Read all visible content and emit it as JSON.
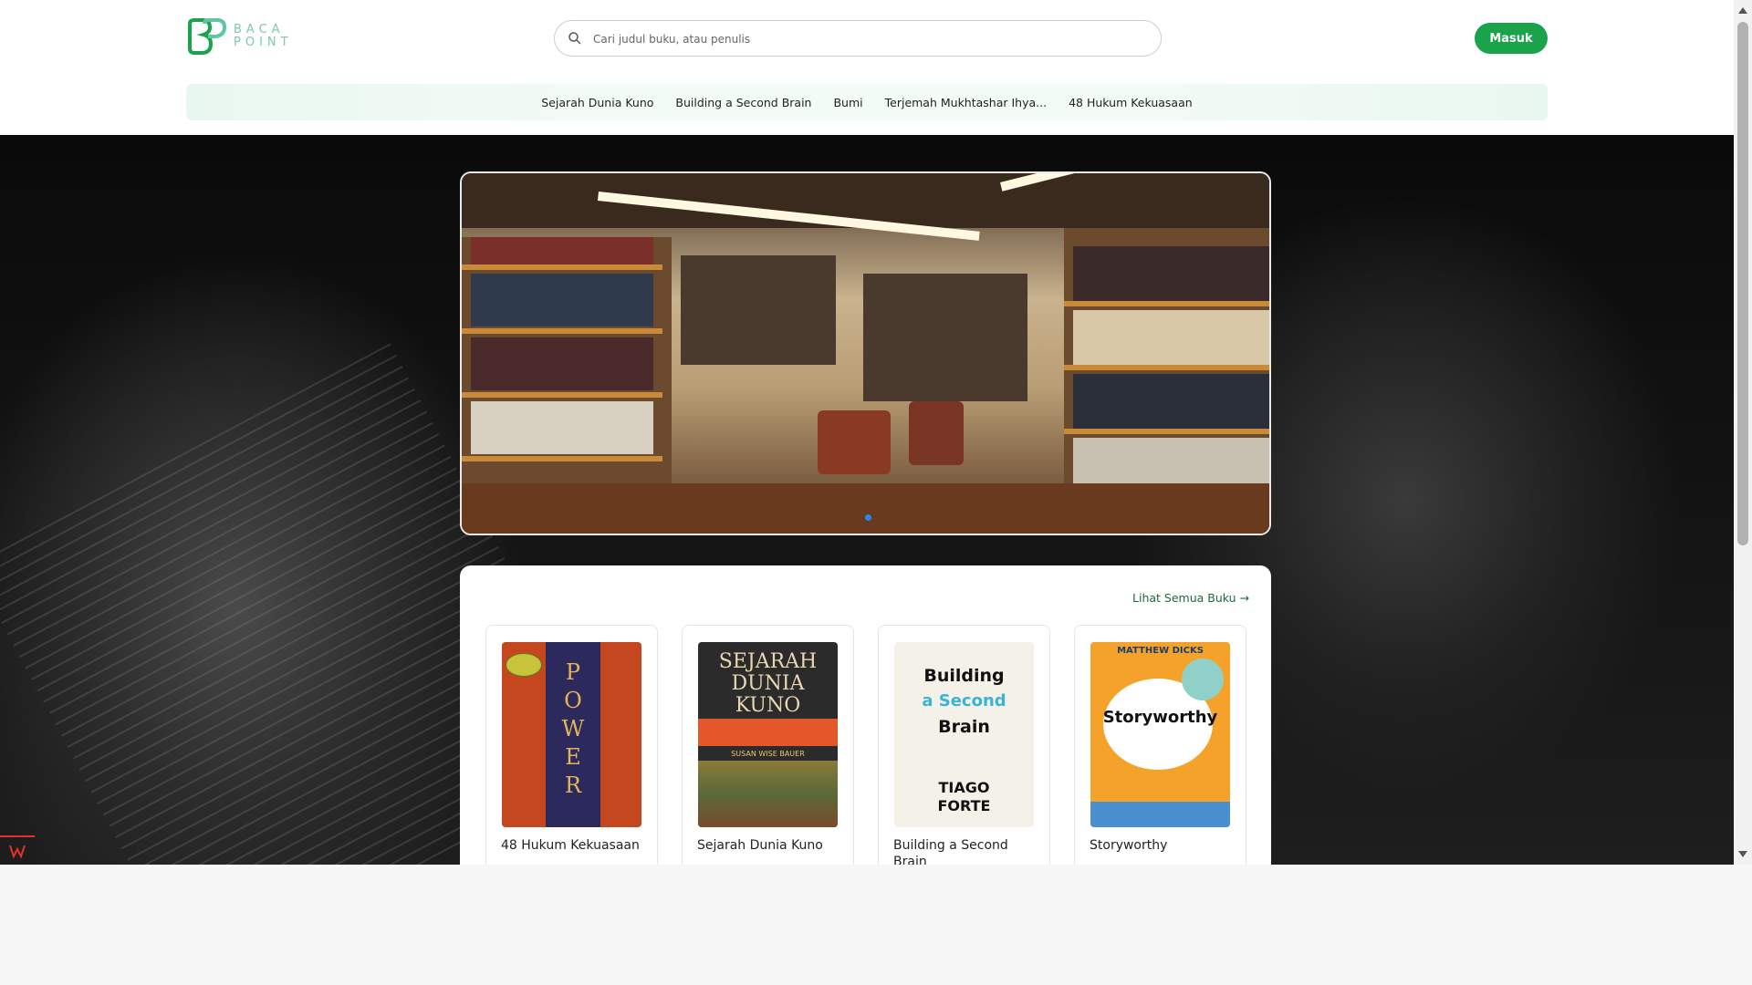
{
  "brand": {
    "name_line1": "BACA",
    "name_line2": "POINT",
    "color": "#1aa34a"
  },
  "search": {
    "placeholder": "Cari judul buku, atau penulis"
  },
  "header": {
    "login_label": "Masuk"
  },
  "nav": {
    "items": [
      {
        "label": "Sejarah Dunia Kuno"
      },
      {
        "label": "Building a Second Brain"
      },
      {
        "label": "Bumi"
      },
      {
        "label": "Terjemah Mukhtashar Ihya..."
      },
      {
        "label": "48 Hukum Kekuasaan"
      }
    ]
  },
  "books_section": {
    "see_all_label": "Lihat Semua Buku →"
  },
  "books": [
    {
      "title": "48 Hukum Kekuasaan",
      "cover_text": "POWER"
    },
    {
      "title": "Sejarah Dunia Kuno",
      "cover_text": "SEJARAH DUNIA KUNO",
      "cover_author": "SUSAN WISE BAUER"
    },
    {
      "title": "Building a Second Brain",
      "cover_lines": [
        "Building",
        "a Second",
        "Brain",
        "TIAGO",
        "FORTE"
      ]
    },
    {
      "title": "Storyworthy",
      "cover_author": "MATTHEW DICKS",
      "cover_text": "Storyworthy"
    }
  ]
}
